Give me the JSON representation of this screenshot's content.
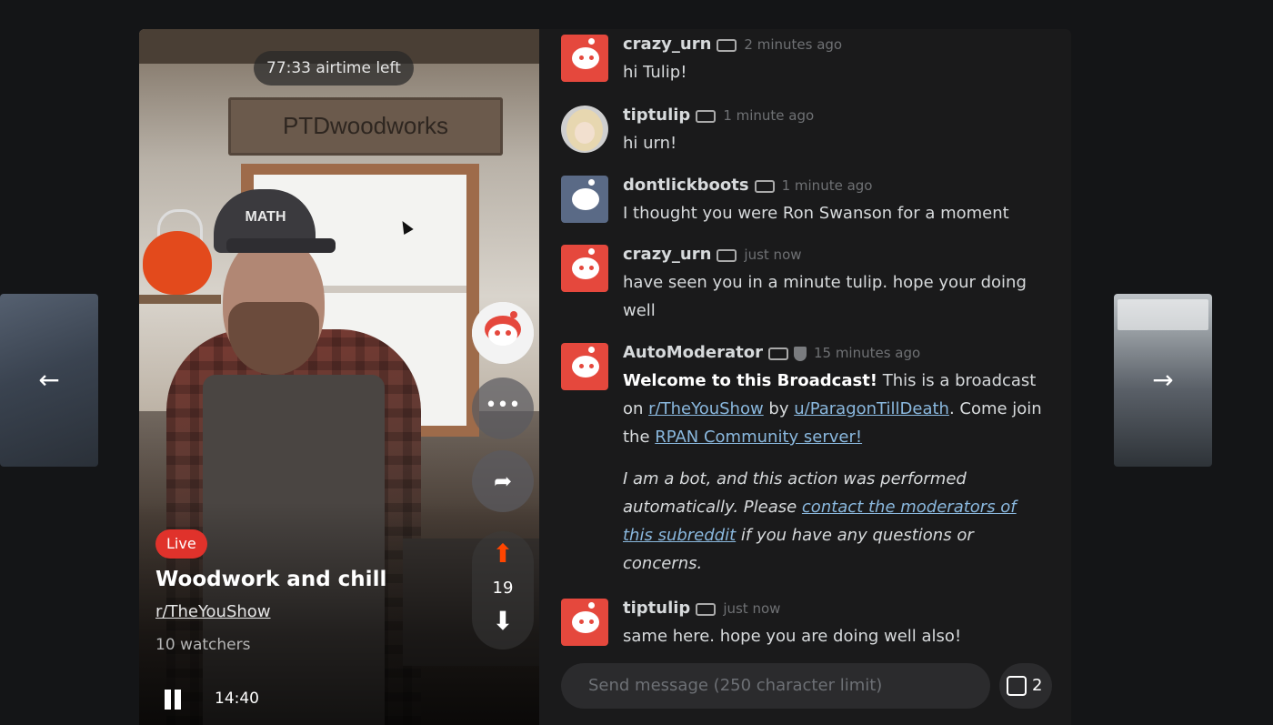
{
  "nav": {
    "prev_arrow": "←",
    "next_arrow": "→"
  },
  "stream": {
    "airtime": "77:33 airtime left",
    "shop_sign": "PTDwoodworks",
    "cap_text": "MATH",
    "live_label": "Live",
    "title": "Woodwork and chill",
    "subreddit": "r/TheYouShow",
    "watchers": "10 watchers",
    "vote_count": "19",
    "more_icon": "•••",
    "share_icon": "➦",
    "upvote_icon": "⬆",
    "downvote_icon": "⬇",
    "time": "14:40"
  },
  "chat": {
    "messages": [
      {
        "user": "crazy_urn",
        "time": "2 minutes ago",
        "text": "hi Tulip!"
      },
      {
        "user": "tiptulip",
        "time": "1 minute ago",
        "text": "hi urn!"
      },
      {
        "user": "dontlickboots",
        "time": "1 minute ago",
        "text": "I thought you were Ron Swanson for a moment"
      },
      {
        "user": "crazy_urn",
        "time": "just now",
        "text": "have seen you in a minute tulip. hope your doing well"
      },
      {
        "user": "AutoModerator",
        "time": "15 minutes ago",
        "bold": "Welcome to this Broadcast!",
        "text1": " This is a broadcast on ",
        "link1": "r/TheYouShow",
        "text2": " by ",
        "link2": "u/ParagonTillDeath",
        "text3": ". Come join the ",
        "link3": "RPAN Community server!",
        "italic1": "I am a bot, and this action was performed automatically. Please ",
        "italic_link": "contact the moderators of this subreddit",
        "italic2": " if you have any questions or concerns."
      },
      {
        "user": "tiptulip",
        "time": "just now",
        "text": "same here. hope you are doing well also!"
      }
    ],
    "input_placeholder": "Send message (250 character limit)",
    "gift_count": "2"
  },
  "colors": {
    "accent": "#ff4500",
    "live": "#e0322b",
    "link": "#8ab8de",
    "background": "#141517"
  }
}
